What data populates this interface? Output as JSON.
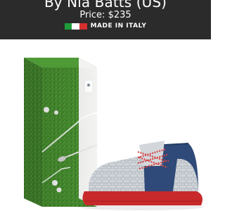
{
  "header": {
    "title": "By Nia Batts (US)",
    "price": "Price: $235",
    "made_in": "MADE IN ITALY"
  },
  "colors": {
    "header_bg": "#2b2b2b",
    "flag_green": "#1f9d3a",
    "flag_white": "#ffffff",
    "flag_red": "#d32f2f",
    "grass": "#3f8a2c",
    "shoe_blue": "#2f4a78",
    "shoe_silver": "#cfd4d9",
    "sole_red": "#c8292b"
  },
  "icons": {
    "flag": "italy-flag-icon"
  }
}
